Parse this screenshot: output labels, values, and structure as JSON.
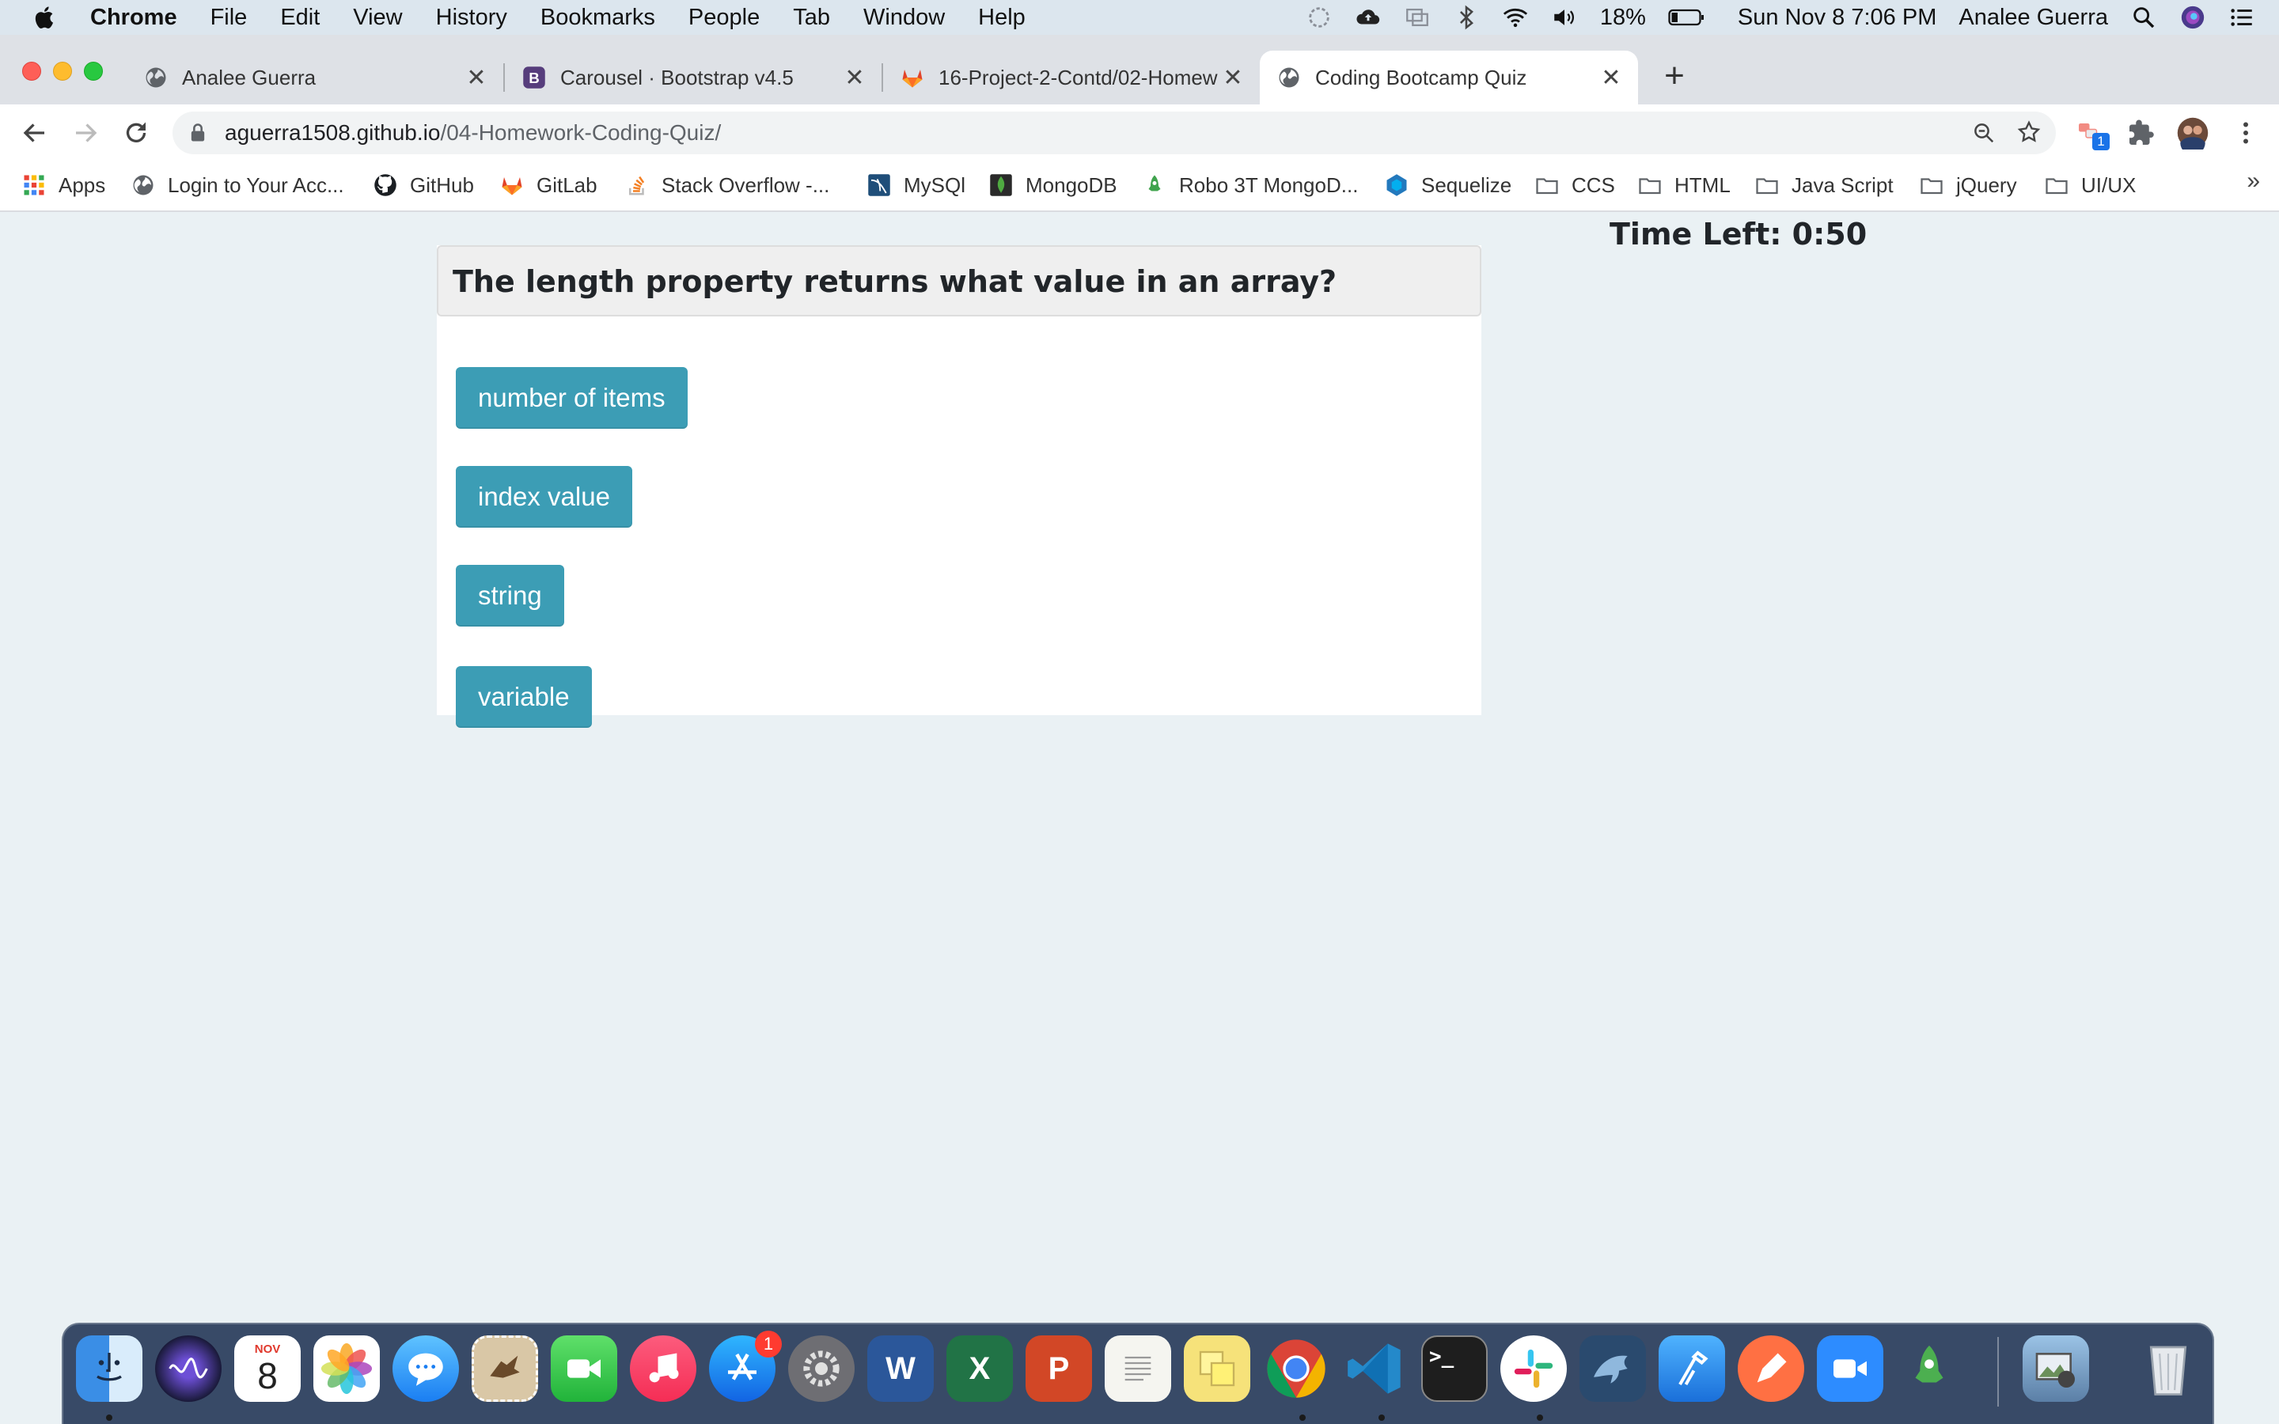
{
  "menubar": {
    "app_name": "Chrome",
    "menus": [
      "File",
      "Edit",
      "View",
      "History",
      "Bookmarks",
      "People",
      "Tab",
      "Window",
      "Help"
    ],
    "battery": "18%",
    "datetime": "Sun Nov 8  7:06 PM",
    "user": "Analee Guerra"
  },
  "tabs": [
    {
      "title": "Analee Guerra",
      "icon": "globe-icon"
    },
    {
      "title": "Carousel · Bootstrap v4.5",
      "icon": "bootstrap-icon"
    },
    {
      "title": "16-Project-2-Contd/02-Homew",
      "icon": "gitlab-icon"
    },
    {
      "title": "Coding Bootcamp Quiz",
      "icon": "globe-icon",
      "active": true
    }
  ],
  "toolbar": {
    "url_host": "aguerra1508.github.io",
    "url_path": "/04-Homework-Coding-Quiz/",
    "extension_badge": "1"
  },
  "bookmarks": [
    {
      "label": "Apps",
      "icon": "apps-grid-icon"
    },
    {
      "label": "Login to Your Acc...",
      "icon": "globe-icon"
    },
    {
      "label": "GitHub",
      "icon": "github-icon"
    },
    {
      "label": "GitLab",
      "icon": "gitlab-icon"
    },
    {
      "label": "Stack Overflow -...",
      "icon": "stackoverflow-icon"
    },
    {
      "label": "MySQl",
      "icon": "mysql-icon"
    },
    {
      "label": "MongoDB",
      "icon": "mongodb-icon"
    },
    {
      "label": "Robo 3T MongoD...",
      "icon": "robo3t-icon"
    },
    {
      "label": "Sequelize",
      "icon": "sequelize-icon"
    },
    {
      "label": "CCS",
      "icon": "folder-icon"
    },
    {
      "label": "HTML",
      "icon": "folder-icon"
    },
    {
      "label": "Java Script",
      "icon": "folder-icon"
    },
    {
      "label": "jQuery",
      "icon": "folder-icon"
    },
    {
      "label": "UI/UX",
      "icon": "folder-icon"
    }
  ],
  "bookmarks_overflow": "»",
  "quiz": {
    "question": "The length property returns what value in an array?",
    "choices": [
      "number of items",
      "index value",
      "string",
      "variable"
    ],
    "timer": "Time Left: 0:50",
    "button_color": "#3c9db5"
  },
  "dock": {
    "calendar_month": "NOV",
    "calendar_day": "8",
    "appstore_badge": "1",
    "apps": [
      "finder",
      "siri",
      "calendar",
      "photos",
      "messages",
      "preview-mail",
      "facetime",
      "music",
      "app-store",
      "system-preferences",
      "word",
      "excel",
      "powerpoint",
      "textedit",
      "stickies",
      "chrome",
      "vscode",
      "terminal",
      "slack",
      "mysql-workbench",
      "xcode",
      "sketch-pen",
      "zoom",
      "robo3t",
      "image-capture",
      "trash"
    ]
  }
}
